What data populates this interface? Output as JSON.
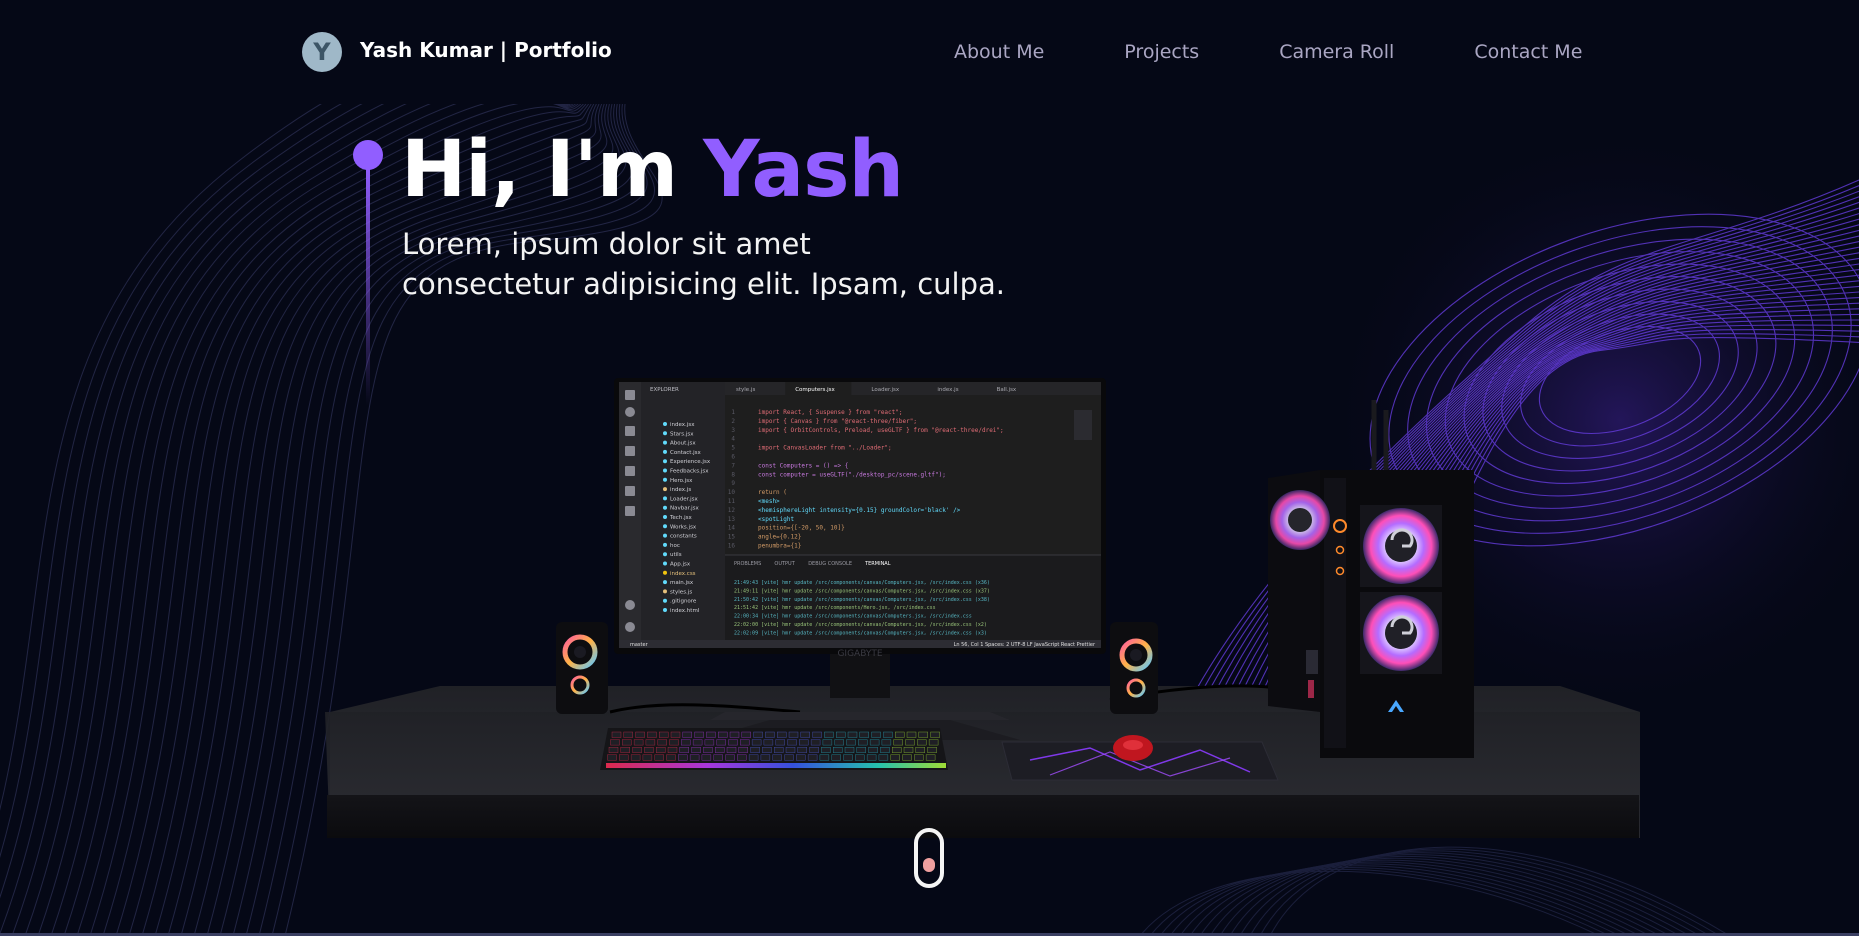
{
  "navbar": {
    "logo_letter": "Y",
    "brand": "Yash Kumar | Portfolio",
    "links": [
      {
        "label": "About Me"
      },
      {
        "label": "Projects"
      },
      {
        "label": "Camera Roll"
      },
      {
        "label": "Contact Me"
      }
    ]
  },
  "hero": {
    "greeting": "Hi, I'm ",
    "name": "Yash",
    "subtitle_line1": "Lorem, ipsum dolor sit amet",
    "subtitle_line2": "consectetur adipisicing elit. Ipsam, culpa."
  },
  "editor": {
    "explorer_label": "EXPLORER",
    "files": [
      "index.jsx",
      "Stars.jsx",
      "About.jsx",
      "Contact.jsx",
      "Experience.jsx",
      "Feedbacks.jsx",
      "Hero.jsx",
      "index.js",
      "Loader.jsx",
      "Navbar.jsx",
      "Tech.jsx",
      "Works.jsx",
      "constants",
      "hoc",
      "utils",
      "App.jsx",
      "index.css",
      "main.jsx",
      "styles.js",
      ".gitignore",
      "index.html"
    ],
    "tabs": [
      "style.js",
      "Computers.jsx",
      "Loader.jsx",
      "index.js",
      "Ball.jsx"
    ],
    "code_lines": [
      "import React, { Suspense } from \"react\";",
      "import { Canvas } from \"@react-three/fiber\";",
      "import { OrbitControls, Preload, useGLTF } from \"@react-three/drei\";",
      "",
      "import CanvasLoader from \"../Loader\";",
      "",
      "const Computers = () => {",
      "  const computer = useGLTF(\"./desktop_pc/scene.gltf\");",
      "",
      "  return (",
      "    <mesh>",
      "      <hemisphereLight intensity={0.15} groundColor='black' />",
      "      <spotLight",
      "        position={[-20, 50, 10]}",
      "        angle={0.12}",
      "        penumbra={1}"
    ],
    "panel_tabs": [
      "PROBLEMS",
      "OUTPUT",
      "DEBUG CONSOLE",
      "TERMINAL"
    ],
    "terminal_lines": [
      "21:49:43 [vite] hmr update /src/components/canvas/Computers.jsx, /src/index.css (x36)",
      "21:49:11 [vite] hmr update /src/components/canvas/Computers.jsx, /src/index.css (x37)",
      "21:50:42 [vite] hmr update /src/components/canvas/Computers.jsx, /src/index.css (x38)",
      "21:51:42 [vite] hmr update /src/components/Hero.jsx, /src/index.css",
      "22:00:34 [vite] hmr update /src/components/canvas/Computers.jsx, /src/index.css",
      "22:02:00 [vite] hmr update /src/components/canvas/Computers.jsx, /src/index.css (x2)",
      "22:02:09 [vite] hmr update /src/components/canvas/Computers.jsx, /src/index.css (x3)"
    ],
    "status_left": "master",
    "status_right": "Ln 56, Col 1   Spaces: 2   UTF-8   LF   JavaScript React   Prettier",
    "monitor_brand": "GIGABYTE"
  },
  "colors": {
    "background": "#050816",
    "accent": "#915eff",
    "nav_text": "#aaa6c3"
  }
}
